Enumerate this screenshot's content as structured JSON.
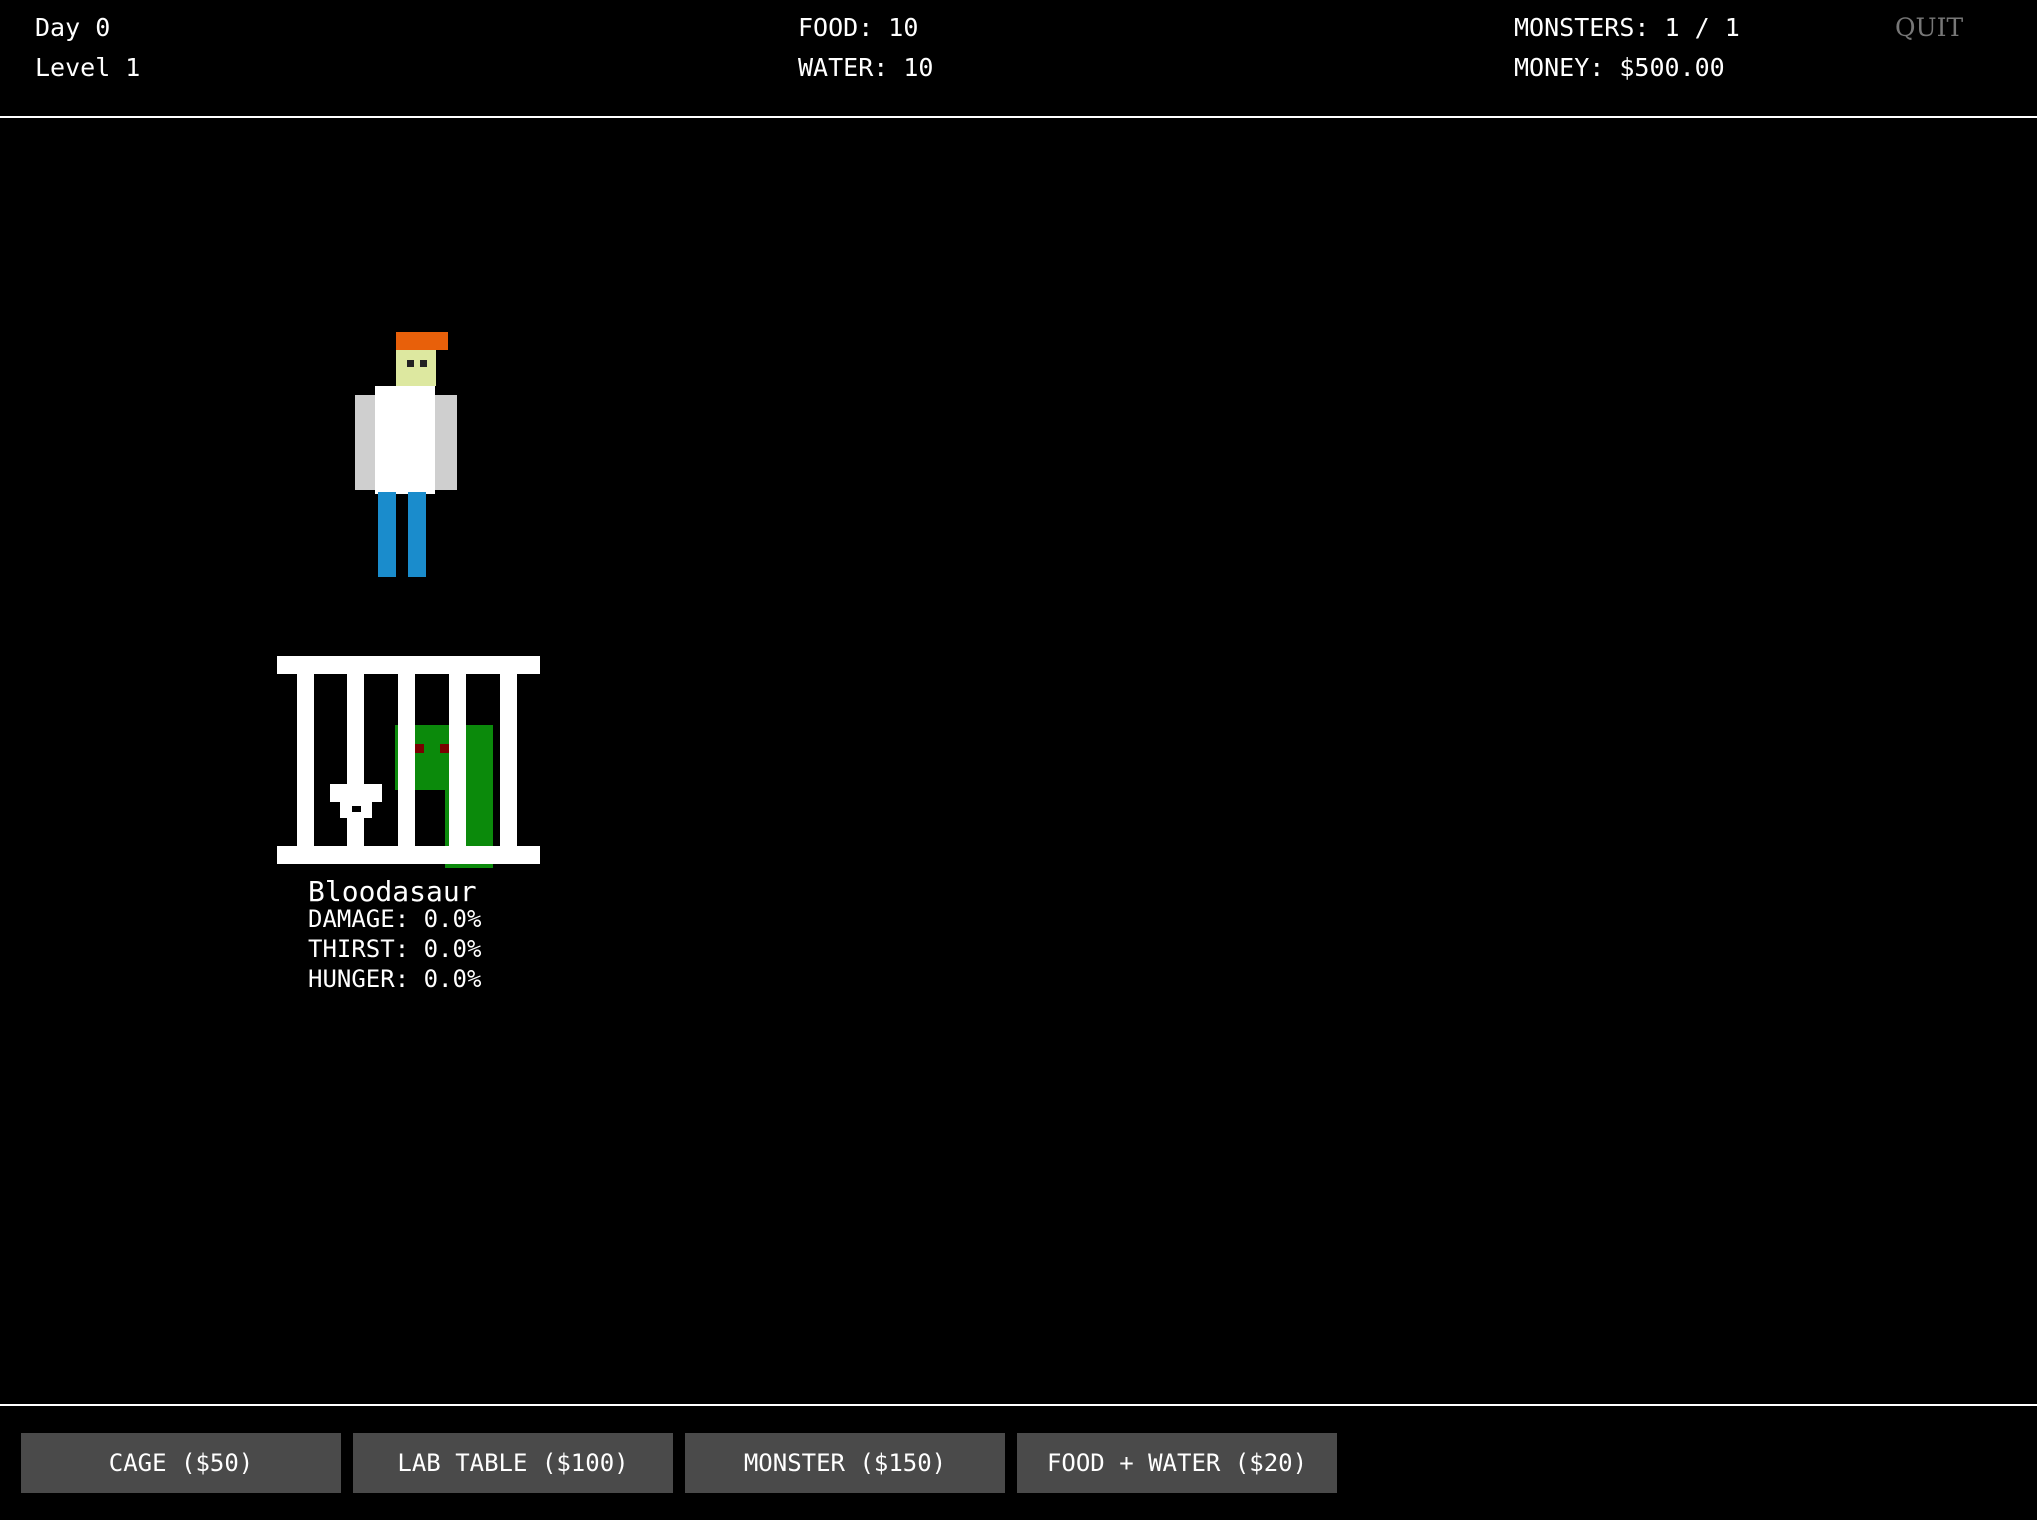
{
  "hud": {
    "day": "Day 0",
    "level": "Level 1",
    "food": "FOOD: 10",
    "water": "WATER: 10",
    "monsters": "MONSTERS: 1 / 1",
    "money": "MONEY: $500.00",
    "quit_label": "QUIT"
  },
  "monster": {
    "name": "Bloodasaur",
    "damage": "DAMAGE: 0.0%",
    "thirst": "THIRST: 0.0%",
    "hunger": "HUNGER: 0.0%"
  },
  "toolbar": {
    "buttons": [
      {
        "label": "CAGE ($50)"
      },
      {
        "label": "LAB TABLE ($100)"
      },
      {
        "label": "MONSTER ($150)"
      },
      {
        "label": "FOOD + WATER ($20)"
      }
    ]
  },
  "colors": {
    "background": "#000000",
    "button_bg": "#4a4a4a",
    "quit_text": "#777777",
    "hair": "#e8600a",
    "skin": "#dde8a0",
    "coat": "#ffffff",
    "pants": "#1a8ccc",
    "monster": "#0b8a0b"
  }
}
